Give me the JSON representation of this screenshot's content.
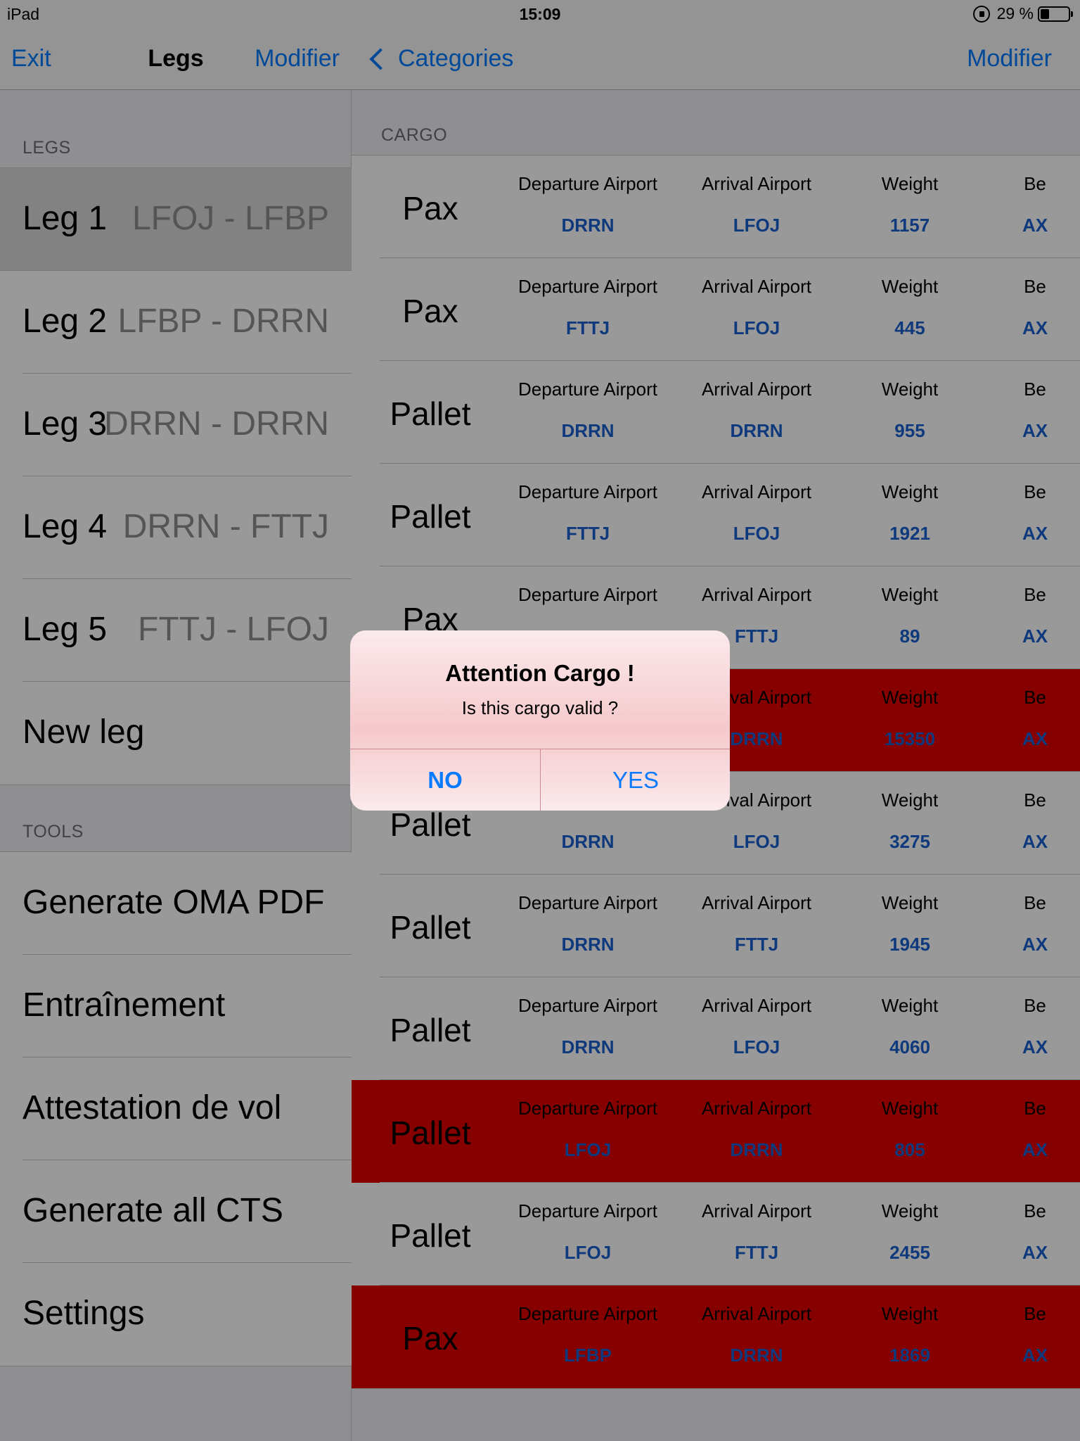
{
  "status": {
    "device": "iPad",
    "time": "15:09",
    "battery": "29 %"
  },
  "master": {
    "nav": {
      "left": "Exit",
      "title": "Legs",
      "right": "Modifier"
    },
    "legs_header": "LEGS",
    "legs": [
      {
        "label": "Leg 1",
        "route": "LFOJ - LFBP",
        "selected": true
      },
      {
        "label": "Leg 2",
        "route": "LFBP - DRRN"
      },
      {
        "label": "Leg 3",
        "route": "DRRN - DRRN"
      },
      {
        "label": "Leg 4",
        "route": "DRRN - FTTJ"
      },
      {
        "label": "Leg 5",
        "route": "FTTJ - LFOJ"
      },
      {
        "label": "New leg",
        "route": ""
      }
    ],
    "tools_header": "TOOLS",
    "tools": [
      {
        "label": "Generate OMA PDF"
      },
      {
        "label": "Entraînement"
      },
      {
        "label": "Attestation de vol"
      },
      {
        "label": "Generate all CTS"
      },
      {
        "label": "Settings"
      }
    ]
  },
  "detail": {
    "nav": {
      "back": "Categories",
      "right": "Modifier"
    },
    "section_header": "CARGO",
    "columns": {
      "dep": "Departure Airport",
      "arr": "Arrival Airport",
      "weight": "Weight",
      "be": "Be"
    },
    "rows": [
      {
        "type": "Pax",
        "dep": "DRRN",
        "arr": "LFOJ",
        "weight": "1157",
        "be": "AX",
        "alert": false
      },
      {
        "type": "Pax",
        "dep": "FTTJ",
        "arr": "LFOJ",
        "weight": "445",
        "be": "AX",
        "alert": false
      },
      {
        "type": "Pallet",
        "dep": "DRRN",
        "arr": "DRRN",
        "weight": "955",
        "be": "AX",
        "alert": false
      },
      {
        "type": "Pallet",
        "dep": "FTTJ",
        "arr": "LFOJ",
        "weight": "1921",
        "be": "AX",
        "alert": false
      },
      {
        "type": "Pax",
        "dep": "",
        "arr": "FTTJ",
        "weight": "89",
        "be": "AX",
        "alert": false
      },
      {
        "type": "",
        "dep": "",
        "arr": "DRRN",
        "weight": "15350",
        "be": "AX",
        "alert": true
      },
      {
        "type": "Pallet",
        "dep": "DRRN",
        "arr": "LFOJ",
        "weight": "3275",
        "be": "AX",
        "alert": false
      },
      {
        "type": "Pallet",
        "dep": "DRRN",
        "arr": "FTTJ",
        "weight": "1945",
        "be": "AX",
        "alert": false
      },
      {
        "type": "Pallet",
        "dep": "DRRN",
        "arr": "LFOJ",
        "weight": "4060",
        "be": "AX",
        "alert": false
      },
      {
        "type": "Pallet",
        "dep": "LFOJ",
        "arr": "DRRN",
        "weight": "805",
        "be": "AX",
        "alert": true
      },
      {
        "type": "Pallet",
        "dep": "LFOJ",
        "arr": "FTTJ",
        "weight": "2455",
        "be": "AX",
        "alert": false
      },
      {
        "type": "Pax",
        "dep": "LFBP",
        "arr": "DRRN",
        "weight": "1869",
        "be": "AX",
        "alert": true
      }
    ]
  },
  "dialog": {
    "title": "Attention Cargo !",
    "message": "Is this cargo valid ?",
    "no": "NO",
    "yes": "YES"
  },
  "colors": {
    "alert_row": "#e10000",
    "value_blue": "#1a60d0",
    "ios_blue": "#007aff"
  }
}
